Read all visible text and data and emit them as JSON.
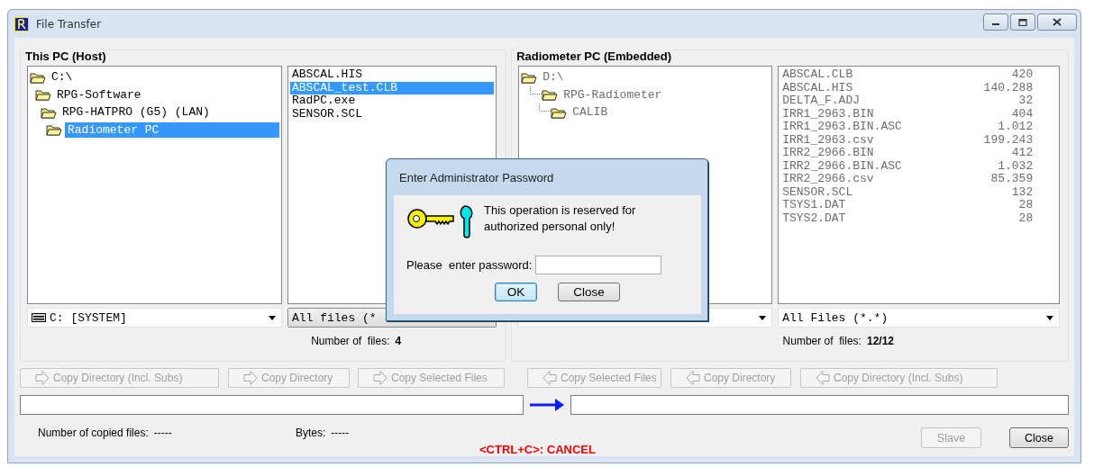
{
  "window": {
    "title": "File Transfer"
  },
  "panels": [
    {
      "title": "This PC (Host)",
      "disabled": false,
      "tree_lines": false,
      "tree": [
        {
          "label": "C:\\",
          "selected": false,
          "children": [
            {
              "label": "RPG-Software",
              "selected": false,
              "children": [
                {
                  "label": "RPG-HATPRO (G5) (LAN)",
                  "selected": false,
                  "children": [
                    {
                      "label": "Radiometer PC",
                      "selected": true
                    }
                  ]
                }
              ]
            }
          ]
        }
      ],
      "files": [
        {
          "name": "ABSCAL.HIS",
          "selected": false
        },
        {
          "name": "ABSCAL_test.CLB",
          "selected": true
        },
        {
          "name": "RadPC.exe",
          "selected": false
        },
        {
          "name": "SENSOR.SCL",
          "selected": false
        }
      ],
      "drive": {
        "value": "C: [SYSTEM]"
      },
      "filter": {
        "value": "All files (*"
      },
      "file_count_label": "Number of  files:",
      "file_count": "4"
    },
    {
      "title": "Radiometer PC (Embedded)",
      "disabled": true,
      "tree_lines": true,
      "tree": [
        {
          "label": "D:\\",
          "selected": false,
          "children": [
            {
              "label": "RPG-Radiometer",
              "selected": false,
              "children": [
                {
                  "label": "CALIB",
                  "selected": false
                }
              ]
            }
          ]
        }
      ],
      "files": [
        {
          "name": "ABSCAL.CLB",
          "size": "420",
          "selected": false
        },
        {
          "name": "ABSCAL.HIS",
          "size": "140.288",
          "selected": false
        },
        {
          "name": "DELTA_F.ADJ",
          "size": "32",
          "selected": false
        },
        {
          "name": "IRR1_2963.BIN",
          "size": "404",
          "selected": false
        },
        {
          "name": "IRR1_2963.BIN.ASC",
          "size": "1.012",
          "selected": false
        },
        {
          "name": "IRR1_2963.csv",
          "size": "199.243",
          "selected": false
        },
        {
          "name": "IRR2_2966.BIN",
          "size": "412",
          "selected": false
        },
        {
          "name": "IRR2_2966.BIN.ASC",
          "size": "1.032",
          "selected": false
        },
        {
          "name": "IRR2_2966.csv",
          "size": "85.359",
          "selected": false
        },
        {
          "name": "SENSOR.SCL",
          "size": "132",
          "selected": false
        },
        {
          "name": "TSYS1.DAT",
          "size": "28",
          "selected": false
        },
        {
          "name": "TSYS2.DAT",
          "size": "28",
          "selected": false
        }
      ],
      "filter": {
        "value": "All Files (*.*)"
      },
      "file_count_label": "Number of  files:",
      "file_count": "12/12"
    }
  ],
  "transfer_buttons": [
    {
      "label": "Copy Directory (Incl. Subs)",
      "kind": "right",
      "disabled": true
    },
    {
      "label": "Copy Directory",
      "kind": "right",
      "disabled": true
    },
    {
      "label": "Copy Selected Files",
      "kind": "right",
      "disabled": true
    },
    {
      "label": "Copy Selected Files",
      "kind": "left",
      "disabled": true
    },
    {
      "label": "Copy Directory",
      "kind": "left",
      "disabled": true
    },
    {
      "label": "Copy Directory (Incl. Subs)",
      "kind": "left",
      "disabled": true
    }
  ],
  "progress": [
    {
      "level": 0
    },
    {
      "level": 0
    }
  ],
  "status": {
    "copied_files_label": "Number of copied files:",
    "copied_files": "-----",
    "bytes_label": "Bytes:",
    "bytes": "-----",
    "cancel_hint": "<CTRL+C>: CANCEL"
  },
  "buttons": [
    {
      "label": "Slave",
      "disabled": true
    },
    {
      "label": "Close",
      "disabled": false
    }
  ],
  "dialog": {
    "title": "Enter Administrator Password",
    "message": "This operation is reserved for authorized personal only!",
    "prompt": "Please  enter password:",
    "buttons": [
      {
        "label": "OK",
        "default": true
      },
      {
        "label": "Close",
        "default": false
      }
    ]
  }
}
